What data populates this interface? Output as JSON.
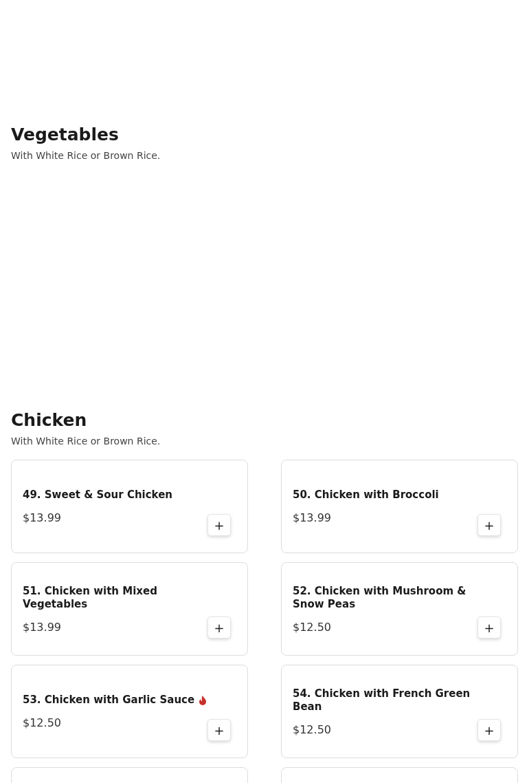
{
  "sections": [
    {
      "title": "Vegetables",
      "subtitle": "With White Rice or Brown Rice."
    },
    {
      "title": "Chicken",
      "subtitle": "With White Rice or Brown Rice.",
      "items": [
        {
          "kind": "dish",
          "name": "49. Sweet & Sour Chicken",
          "price": "$13.99",
          "spicy": false,
          "add": "+"
        },
        {
          "kind": "dish",
          "name": "50. Chicken with Broccoli",
          "price": "$13.99",
          "spicy": false,
          "add": "+"
        },
        {
          "kind": "dish",
          "name": "51. Chicken with Mixed Vegetables",
          "price": "$13.99",
          "spicy": false,
          "add": "+"
        },
        {
          "kind": "dish",
          "name": "52. Chicken with Mushroom & Snow Peas",
          "price": "$12.50",
          "spicy": false,
          "add": "+"
        },
        {
          "kind": "dish",
          "name": "53. Chicken with Garlic Sauce",
          "price": "$12.50",
          "spicy": true,
          "add": "+"
        },
        {
          "kind": "dish",
          "name": "54. Chicken with French Green Bean",
          "price": "$12.50",
          "spicy": false,
          "add": "+"
        },
        {
          "kind": "cut_off"
        },
        {
          "kind": "cut_off"
        }
      ]
    }
  ]
}
